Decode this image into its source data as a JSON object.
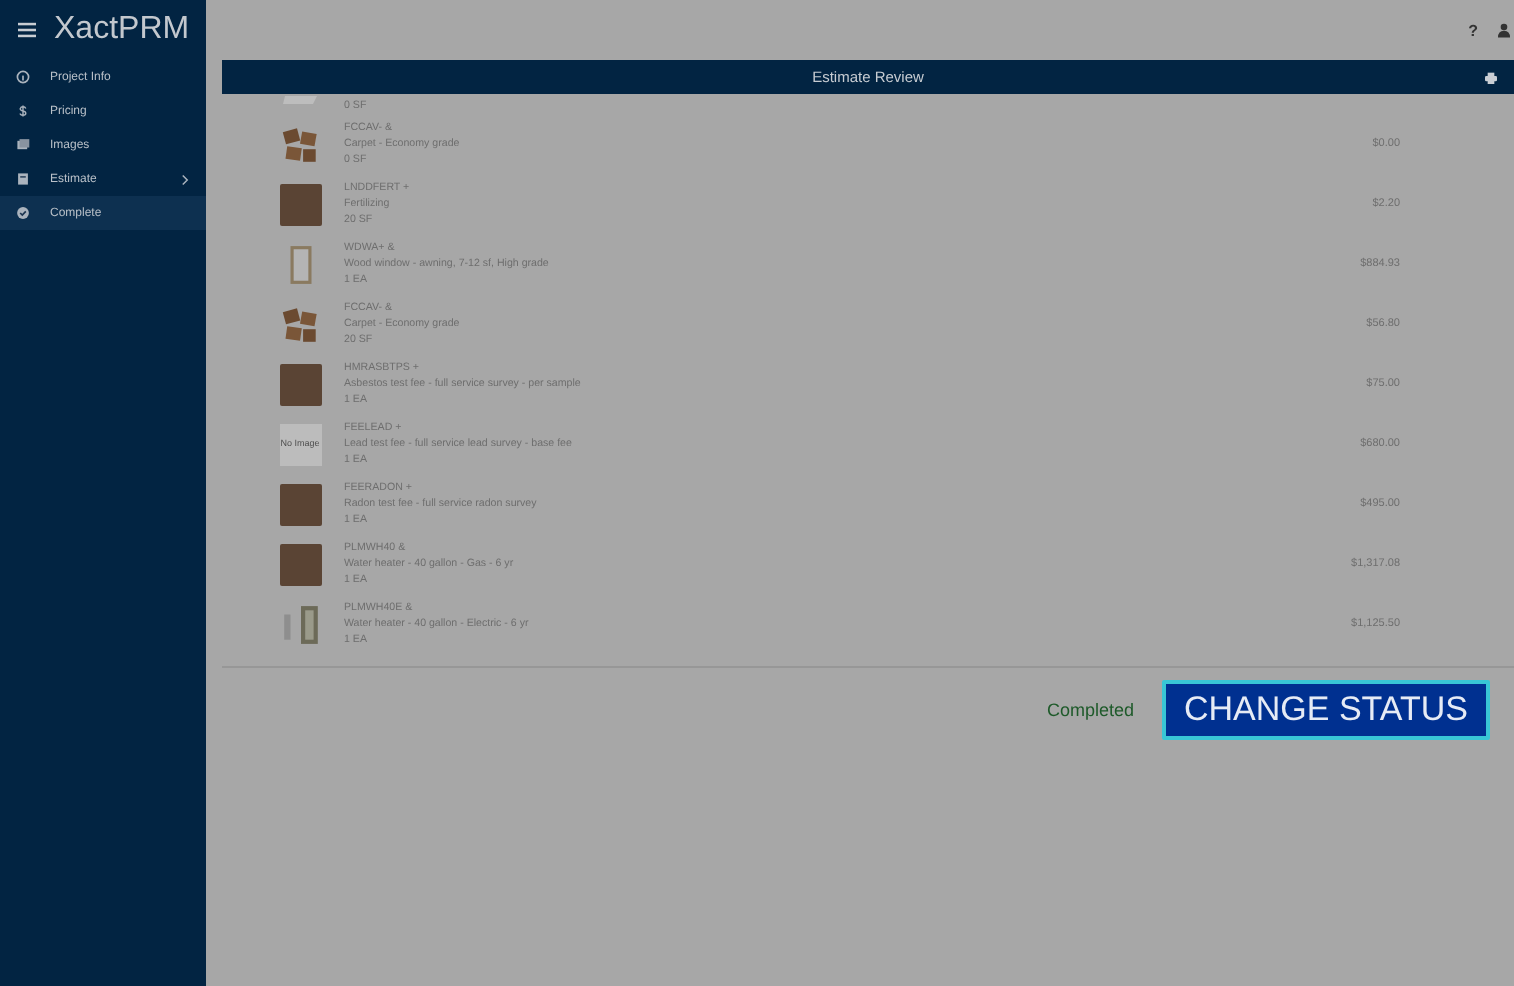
{
  "app": {
    "title": "XactPRM"
  },
  "sidebar": {
    "items": [
      {
        "label": "Project Info",
        "selected": false,
        "has_submenu": false
      },
      {
        "label": "Pricing",
        "selected": false,
        "has_submenu": false
      },
      {
        "label": "Images",
        "selected": false,
        "has_submenu": false
      },
      {
        "label": "Estimate",
        "selected": false,
        "has_submenu": true
      },
      {
        "label": "Complete",
        "selected": true,
        "has_submenu": false
      }
    ]
  },
  "topbar": {
    "help": "?"
  },
  "panel": {
    "title": "Estimate Review",
    "items": [
      {
        "thumb": {
          "kind": "ceiling"
        },
        "quantity": "0 SF"
      },
      {
        "thumb": {
          "kind": "carpet"
        },
        "code": "FCCAV- &",
        "description": "Carpet - Economy grade",
        "quantity": "0 SF",
        "price": "$0.00"
      },
      {
        "thumb": {
          "kind": "photo"
        },
        "code": "LNDDFERT +",
        "description": "Fertilizing",
        "quantity": "20 SF",
        "price": "$2.20"
      },
      {
        "thumb": {
          "kind": "window"
        },
        "code": "WDWA+ &",
        "description": "Wood window - awning, 7-12 sf, High grade",
        "quantity": "1 EA",
        "price": "$884.93"
      },
      {
        "thumb": {
          "kind": "carpet"
        },
        "code": "FCCAV- &",
        "description": "Carpet - Economy grade",
        "quantity": "20 SF",
        "price": "$56.80"
      },
      {
        "thumb": {
          "kind": "photo"
        },
        "code": "HMRASBTPS +",
        "description": "Asbestos test fee - full service survey - per sample",
        "quantity": "1 EA",
        "price": "$75.00"
      },
      {
        "thumb": {
          "kind": "no_image",
          "text": "No Image"
        },
        "code": "FEELEAD +",
        "description": "Lead test fee - full service lead survey - base fee",
        "quantity": "1 EA",
        "price": "$680.00"
      },
      {
        "thumb": {
          "kind": "photo"
        },
        "code": "FEERADON +",
        "description": "Radon test fee - full service radon survey",
        "quantity": "1 EA",
        "price": "$495.00"
      },
      {
        "thumb": {
          "kind": "photo"
        },
        "code": "PLMWH40 &",
        "description": "Water heater - 40 gallon - Gas - 6 yr",
        "quantity": "1 EA",
        "price": "$1,317.08"
      },
      {
        "thumb": {
          "kind": "heaters"
        },
        "code": "PLMWH40E &",
        "description": "Water heater - 40 gallon - Electric - 6 yr",
        "quantity": "1 EA",
        "price": "$1,125.50"
      }
    ]
  },
  "footer": {
    "status": "Completed",
    "button": "CHANGE STATUS"
  }
}
